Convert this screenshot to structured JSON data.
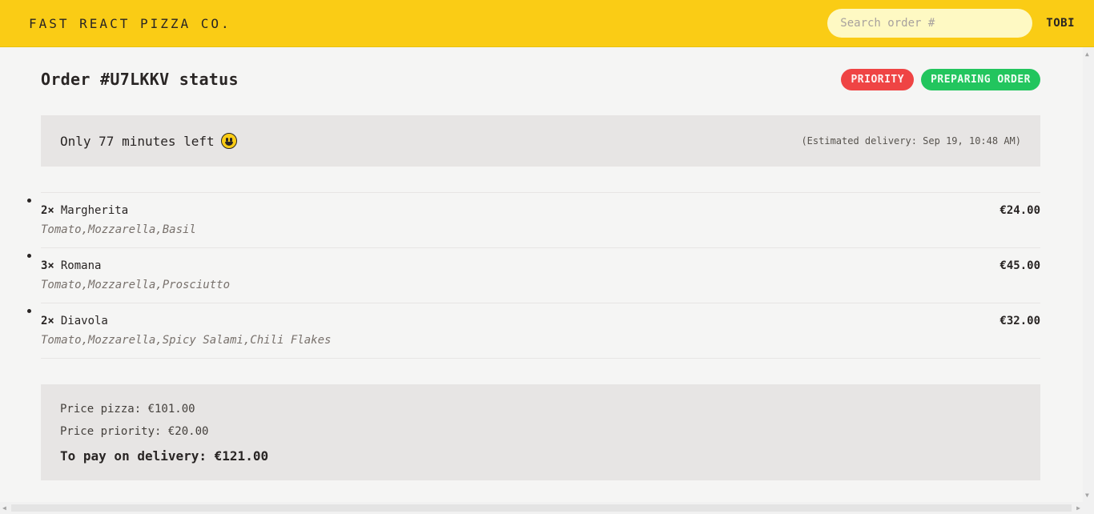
{
  "header": {
    "logo": "Fast React Pizza Co.",
    "search_placeholder": "Search order #",
    "username": "TOBI"
  },
  "order": {
    "title": "Order #U7LKKV status",
    "badges": {
      "priority": "Priority",
      "status": "Preparing order"
    },
    "eta": {
      "message": "Only 77 minutes left",
      "emoji": "smiling-face-icon",
      "estimated": "(Estimated delivery: Sep 19, 10:48 AM)"
    },
    "items": [
      {
        "qty": "2×",
        "name": "Margherita",
        "price": "€24.00",
        "ingredients": "Tomato,Mozzarella,Basil"
      },
      {
        "qty": "3×",
        "name": "Romana",
        "price": "€45.00",
        "ingredients": "Tomato,Mozzarella,Prosciutto"
      },
      {
        "qty": "2×",
        "name": "Diavola",
        "price": "€32.00",
        "ingredients": "Tomato,Mozzarella,Spicy Salami,Chili Flakes"
      }
    ],
    "totals": {
      "pizza": "Price pizza: €101.00",
      "priority": "Price priority: €20.00",
      "pay": "To pay on delivery: €121.00"
    }
  },
  "colors": {
    "header_bg": "#facc15",
    "priority_badge": "#ef4444",
    "status_badge": "#22c55e",
    "panel_bg": "#e7e5e4"
  }
}
